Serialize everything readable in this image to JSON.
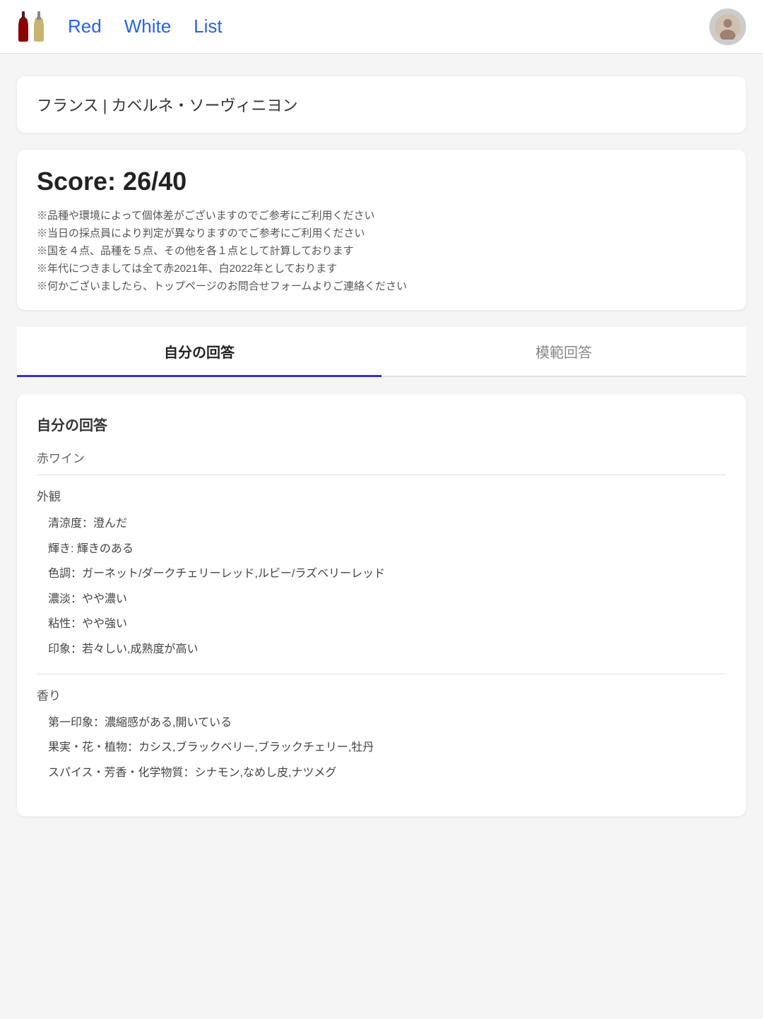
{
  "header": {
    "nav": [
      {
        "label": "Red",
        "id": "red"
      },
      {
        "label": "White",
        "id": "white"
      },
      {
        "label": "List",
        "id": "list"
      }
    ],
    "avatar_char": "👤"
  },
  "wine_label": "フランス | カベルネ・ソーヴィニヨン",
  "score": {
    "title": "Score: 26/40",
    "notes": [
      "※品種や環境によって個体差がございますのでご参考にご利用ください",
      "※当日の採点員により判定が異なりますのでご参考にご利用ください",
      "※国を４点、品種を５点、その他を各１点として計算しております",
      "※年代につきましては全て赤2021年、白2022年としております",
      "※何かございましたら、トップページのお問合せフォームよりご連絡ください"
    ]
  },
  "tabs": [
    {
      "label": "自分の回答",
      "active": true
    },
    {
      "label": "模範回答",
      "active": false
    }
  ],
  "answer": {
    "section_title": "自分の回答",
    "wine_type": "赤ワイン",
    "categories": [
      {
        "title": "外観",
        "details": [
          "清涼度：澄んだ",
          "輝き: 輝きのある",
          "色調：ガーネット/ダークチェリーレッド,ルビー/ラズベリーレッド",
          "濃淡：やや濃い",
          "粘性：やや強い",
          "印象：若々しい,成熟度が高い"
        ]
      },
      {
        "title": "香り",
        "details": [
          "第一印象：濃縮感がある,開いている",
          "果実・花・植物：カシス,ブラックベリー,ブラックチェリー,牡丹",
          "スパイス・芳香・化学物質：シナモン,なめし皮,ナツメグ"
        ]
      }
    ]
  }
}
